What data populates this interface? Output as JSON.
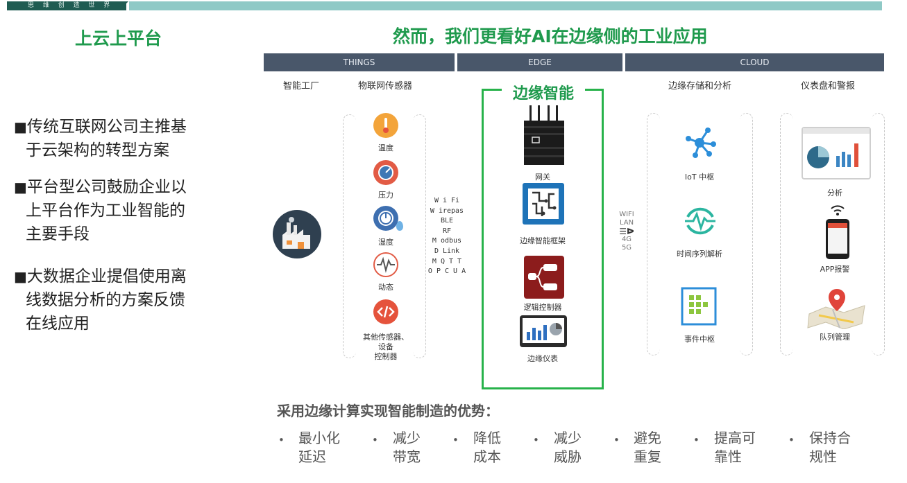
{
  "banner": {
    "brand": "思 维 创 造 世 界"
  },
  "left_title": "上云上平台",
  "main_title": "然而，我们更看好AI在边缘侧的工业应用",
  "bullets": [
    {
      "line1": "传统互联网公司主推基",
      "line2": "于云架构的转型方案"
    },
    {
      "line1": "平台型公司鼓励企业以",
      "line2": "上平台作为工业智能的",
      "line3": "主要手段"
    },
    {
      "line1": "大数据企业提倡使用离",
      "line2": "线数据分析的方案反馈",
      "line3": "在线应用"
    }
  ],
  "sections": {
    "things": "THINGS",
    "edge": "EDGE",
    "cloud": "CLOUD"
  },
  "subheaders": {
    "factory": "智能工厂",
    "sensors": "物联网传感器",
    "storage": "边缘存储和分析",
    "dashboard": "仪表盘和警报"
  },
  "sensors": [
    "温度",
    "压力",
    "湿度",
    "动态"
  ],
  "sensor_other": {
    "line1": "其他传感器、",
    "line2": "设备",
    "line3": "控制器"
  },
  "protocols": [
    "W i Fi",
    "W irepas",
    "BLE",
    "RF",
    "M odbus",
    "D Link",
    "M Q T T",
    "O P C U A"
  ],
  "edge": {
    "title": "边缘智能",
    "items": [
      "网关",
      "边缘智能框架",
      "逻辑控制器",
      "边缘仪表"
    ]
  },
  "network": [
    "WIFI",
    "LAN",
    "4G",
    "5G"
  ],
  "cloud": [
    "IoT 中枢",
    "时间序列解析",
    "事件中枢"
  ],
  "dashboard": [
    "分析",
    "APP报警",
    "队列管理"
  ],
  "advantages": {
    "title": "采用边缘计算实现智能制造的优势：",
    "items": [
      {
        "line1": "最小化",
        "line2": "延迟"
      },
      {
        "line1": "减少",
        "line2": "带宽"
      },
      {
        "line1": "降低",
        "line2": "成本"
      },
      {
        "line1": "减少",
        "line2": "威胁"
      },
      {
        "line1": "避免",
        "line2": "重复"
      },
      {
        "line1": "提高可",
        "line2": "靠性"
      },
      {
        "line1": "保持合",
        "line2": "规性"
      }
    ]
  },
  "colors": {
    "accent_green": "#1f9a4d",
    "edge_box": "#27b24a",
    "header_bar": "#49576a",
    "banner_teal": "#8fc9c6"
  }
}
